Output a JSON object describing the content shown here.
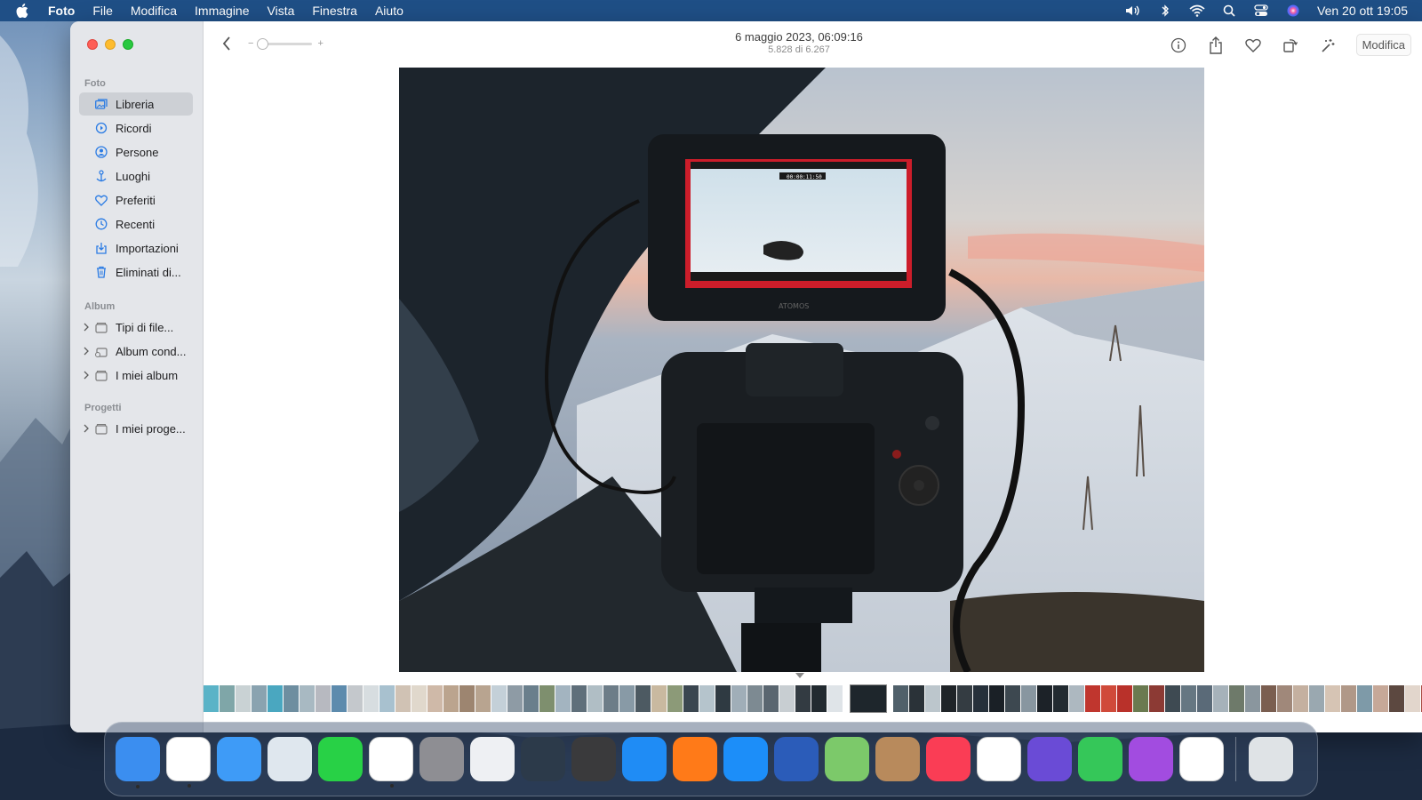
{
  "menubar": {
    "app_name": "Foto",
    "menus": [
      "File",
      "Modifica",
      "Immagine",
      "Vista",
      "Finestra",
      "Aiuto"
    ],
    "clock": "Ven 20 ott  19:05",
    "status_icons": [
      "volume-icon",
      "bluetooth-icon",
      "wifi-icon",
      "spotlight-icon",
      "control-center-icon",
      "siri-icon"
    ]
  },
  "sidebar": {
    "sections": {
      "foto": "Foto",
      "album": "Album",
      "progetti": "Progetti"
    },
    "library_items": [
      {
        "label": "Libreria",
        "icon": "library-icon",
        "active": true
      },
      {
        "label": "Ricordi",
        "icon": "memories-icon"
      },
      {
        "label": "Persone",
        "icon": "people-icon"
      },
      {
        "label": "Luoghi",
        "icon": "places-icon"
      },
      {
        "label": "Preferiti",
        "icon": "heart-icon"
      },
      {
        "label": "Recenti",
        "icon": "clock-icon"
      },
      {
        "label": "Importazioni",
        "icon": "import-icon"
      },
      {
        "label": "Eliminati di...",
        "icon": "trash-icon"
      }
    ],
    "album_items": [
      {
        "label": "Tipi di file...",
        "icon": "folder-icon"
      },
      {
        "label": "Album cond...",
        "icon": "shared-album-icon"
      },
      {
        "label": "I miei album",
        "icon": "folder-icon"
      }
    ],
    "project_items": [
      {
        "label": "I miei proge...",
        "icon": "folder-icon"
      }
    ]
  },
  "toolbar": {
    "title_date": "6 maggio 2023, 06:09:16",
    "title_count": "5.828 di 6.267",
    "zoom_minus": "−",
    "zoom_plus": "+",
    "zoom_level": 0.0,
    "edit_label": "Modifica",
    "actions": [
      "info-icon",
      "share-icon",
      "favorite-heart-icon",
      "rotate-icon",
      "auto-enhance-icon"
    ]
  },
  "photo": {
    "subject": "Camera with external monitor overlooking a snowy mountain at dawn",
    "monitor_timecode": "00:00:11:50",
    "monitor_brand": "ATOMOS"
  },
  "filmstrip": {
    "thumbnail_count": 76,
    "colors": [
      "#5ab3c7",
      "#7fa6a8",
      "#c9d2d4",
      "#8aa3b0",
      "#4aa7c0",
      "#6e8ea0",
      "#a8b9c2",
      "#b7b9c0",
      "#5d8bad",
      "#c4c8cc",
      "#d7dde0",
      "#a8c1cf",
      "#d0c2b4",
      "#e0d8cc",
      "#cfb9a8",
      "#bba48e",
      "#9d8570",
      "#b8a490",
      "#c4d0d8",
      "#8e9ba5",
      "#6a7f8c",
      "#7e8f6e",
      "#a3b4c0",
      "#5f6f7a",
      "#b0bec5",
      "#6d7d88",
      "#889aa6",
      "#4d5a62",
      "#c9b9a0",
      "#8c9a78",
      "#3a4650",
      "#b5c4cc",
      "#2f3a42",
      "#a0aeb8",
      "#7d8a92",
      "#5a6670",
      "#c8ced2",
      "#333b42",
      "#222a30",
      "#dfe4e8",
      "#1e262c",
      "#50606a",
      "#2a3238",
      "#bcc6cc",
      "#1f2428",
      "#343c42",
      "#26303a",
      "#1a2026",
      "#3d4850",
      "#8896a0",
      "#1c2228",
      "#222a30",
      "#adb8c0",
      "#c0362e",
      "#d04a3a",
      "#b9312a",
      "#6a7a50",
      "#8c3a34",
      "#3e4a52",
      "#667782",
      "#5a6a78",
      "#a6b2ba",
      "#6e7a6a",
      "#8a969e",
      "#7a5e50",
      "#a0887a",
      "#c4b0a0",
      "#9aa8b0",
      "#d6c4b4",
      "#b09888",
      "#7e9aa8",
      "#c6a898",
      "#5c4840",
      "#e2d6cc",
      "#a84a40",
      "#6b7d5a"
    ]
  },
  "dock": {
    "apps": [
      {
        "name": "finder-icon",
        "color": "#3b8ef0",
        "running": true
      },
      {
        "name": "chrome-icon",
        "color": "#ffffff",
        "running": true
      },
      {
        "name": "mail-icon",
        "color": "#3e9bf7"
      },
      {
        "name": "preview-icon",
        "color": "#dfe7ee"
      },
      {
        "name": "whatsapp-icon",
        "color": "#28d146"
      },
      {
        "name": "photos-icon",
        "color": "#ffffff",
        "running": true
      },
      {
        "name": "system-settings-icon",
        "color": "#8e8e93"
      },
      {
        "name": "launchpad-icon",
        "color": "#eef0f3"
      },
      {
        "name": "quicktime-icon",
        "color": "#2c3a4a"
      },
      {
        "name": "calculator-icon",
        "color": "#3a3a3c"
      },
      {
        "name": "safari-icon",
        "color": "#1f8cf5"
      },
      {
        "name": "firefox-icon",
        "color": "#ff7a18"
      },
      {
        "name": "app-store-icon",
        "color": "#1c8ef9"
      },
      {
        "name": "word-icon",
        "color": "#2b5cb9"
      },
      {
        "name": "maps-icon",
        "color": "#7cc96a"
      },
      {
        "name": "contacts-icon",
        "color": "#b88a5c"
      },
      {
        "name": "music-icon",
        "color": "#fa3d55"
      },
      {
        "name": "reminders-icon",
        "color": "#ffffff"
      },
      {
        "name": "imovie-icon",
        "color": "#6a4bd6"
      },
      {
        "name": "facetime-icon",
        "color": "#35c759"
      },
      {
        "name": "podcasts-icon",
        "color": "#a24ce0"
      },
      {
        "name": "vlc-icon",
        "color": "#ffffff"
      }
    ],
    "trash": {
      "name": "trash-icon",
      "color": "#dfe3e6"
    }
  }
}
